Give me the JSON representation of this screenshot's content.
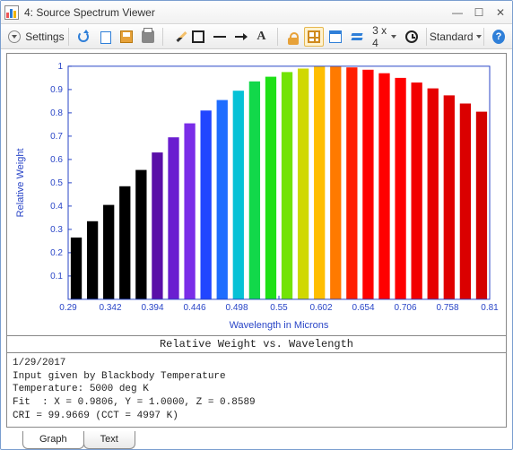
{
  "window": {
    "title": "4: Source Spectrum Viewer"
  },
  "toolbar": {
    "settings_label": "Settings",
    "layout_label": "3 x 4",
    "standard_label": "Standard"
  },
  "chart_caption": "Relative Weight vs. Wavelength",
  "info": {
    "date": "1/29/2017",
    "l1": "Input given by Blackbody Temperature",
    "l2": "Temperature: 5000 deg K",
    "l3": "Fit  : X = 0.9806, Y = 1.0000, Z = 0.8589",
    "l4": "CRI = 99.9669 (CCT = 4997 K)"
  },
  "tabs": {
    "graph": "Graph",
    "text": "Text"
  },
  "chart_data": {
    "type": "bar",
    "title": "Relative Weight vs. Wavelength",
    "xlabel": "Wavelength in Microns",
    "ylabel": "Relative Weight",
    "xlim": [
      0.29,
      0.81
    ],
    "ylim": [
      0,
      1
    ],
    "x_ticks": [
      0.29,
      0.342,
      0.394,
      0.446,
      0.498,
      0.55,
      0.602,
      0.654,
      0.706,
      0.758,
      0.81
    ],
    "y_ticks": [
      0.1,
      0.2,
      0.3,
      0.4,
      0.5,
      0.6,
      0.7,
      0.8,
      0.9,
      1
    ],
    "bars": [
      {
        "x": 0.3,
        "y": 0.265,
        "color": "#000000"
      },
      {
        "x": 0.32,
        "y": 0.335,
        "color": "#000000"
      },
      {
        "x": 0.34,
        "y": 0.405,
        "color": "#000000"
      },
      {
        "x": 0.36,
        "y": 0.485,
        "color": "#000000"
      },
      {
        "x": 0.38,
        "y": 0.555,
        "color": "#000000"
      },
      {
        "x": 0.4,
        "y": 0.63,
        "color": "#5a0ea8"
      },
      {
        "x": 0.42,
        "y": 0.695,
        "color": "#6a1ed0"
      },
      {
        "x": 0.44,
        "y": 0.755,
        "color": "#7a2de8"
      },
      {
        "x": 0.46,
        "y": 0.81,
        "color": "#2146ff"
      },
      {
        "x": 0.48,
        "y": 0.855,
        "color": "#1f6dff"
      },
      {
        "x": 0.5,
        "y": 0.895,
        "color": "#06c1d6"
      },
      {
        "x": 0.52,
        "y": 0.935,
        "color": "#12d84a"
      },
      {
        "x": 0.54,
        "y": 0.955,
        "color": "#1ee016"
      },
      {
        "x": 0.56,
        "y": 0.975,
        "color": "#73e305"
      },
      {
        "x": 0.58,
        "y": 0.99,
        "color": "#d0d800"
      },
      {
        "x": 0.6,
        "y": 1.0,
        "color": "#ffbe00"
      },
      {
        "x": 0.62,
        "y": 1.0,
        "color": "#ff7a00"
      },
      {
        "x": 0.64,
        "y": 0.995,
        "color": "#ff1e00"
      },
      {
        "x": 0.66,
        "y": 0.985,
        "color": "#ff0000"
      },
      {
        "x": 0.68,
        "y": 0.97,
        "color": "#ff0000"
      },
      {
        "x": 0.7,
        "y": 0.95,
        "color": "#ff0000"
      },
      {
        "x": 0.72,
        "y": 0.93,
        "color": "#f20000"
      },
      {
        "x": 0.74,
        "y": 0.905,
        "color": "#e60000"
      },
      {
        "x": 0.76,
        "y": 0.875,
        "color": "#e00000"
      },
      {
        "x": 0.78,
        "y": 0.84,
        "color": "#da0000"
      },
      {
        "x": 0.8,
        "y": 0.805,
        "color": "#d40000"
      }
    ]
  }
}
